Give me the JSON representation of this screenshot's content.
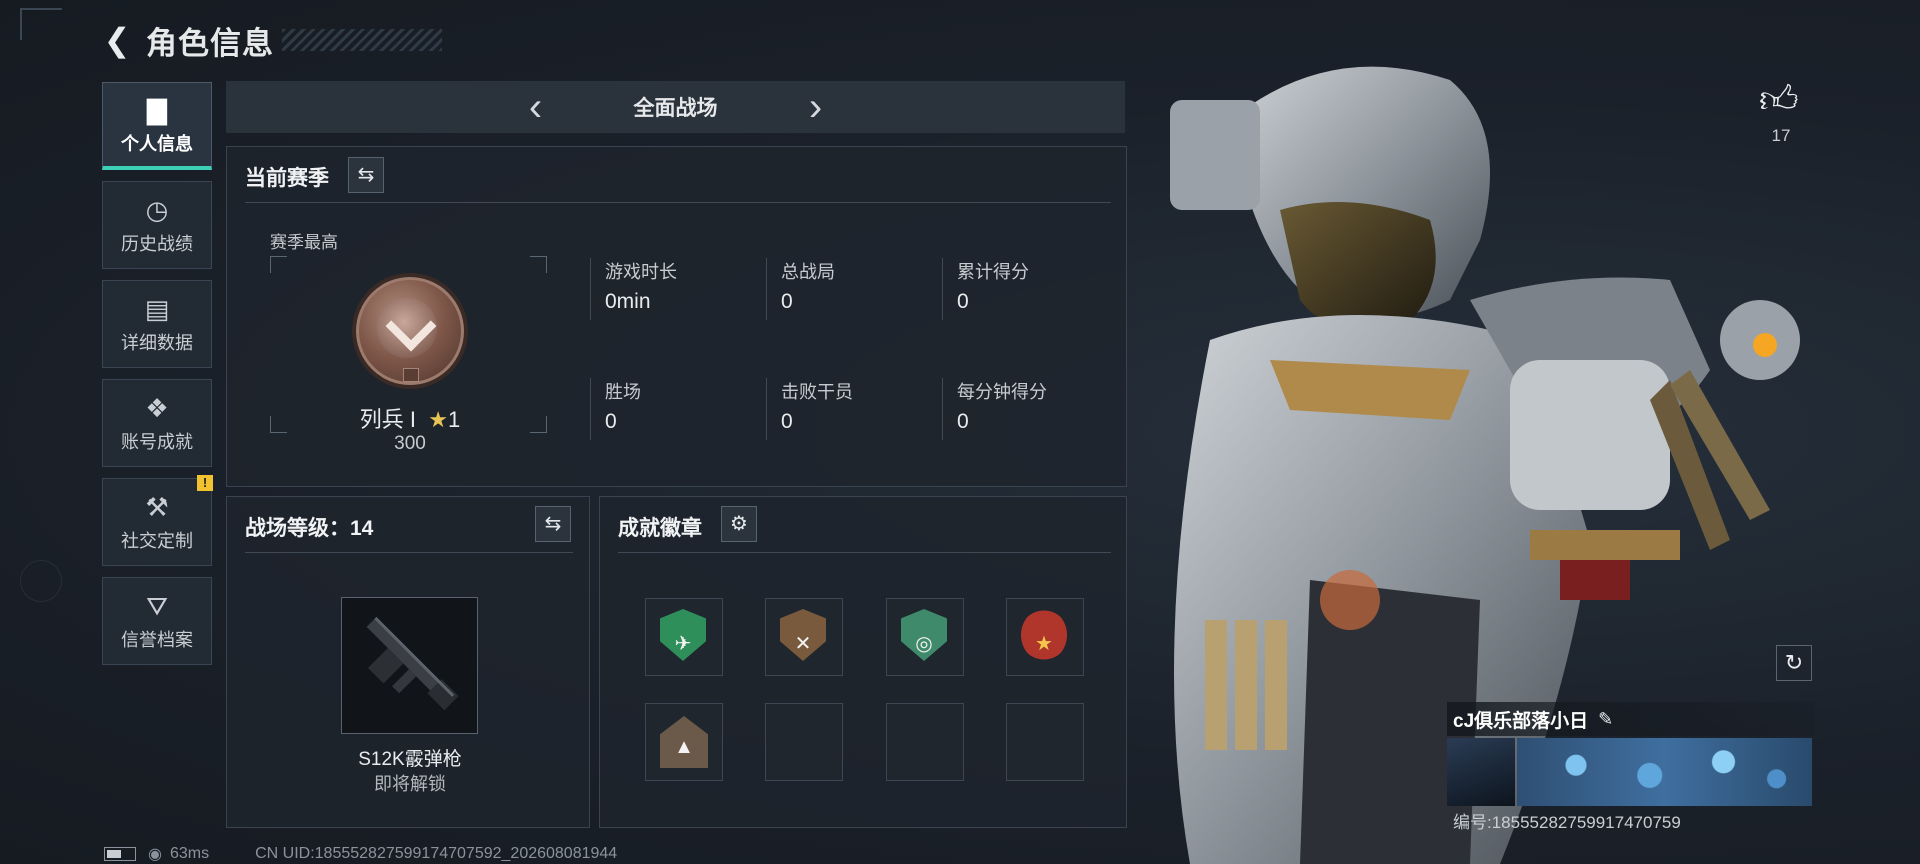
{
  "header": {
    "title": "角色信息"
  },
  "sidebar": {
    "items": [
      {
        "label": "个人信息"
      },
      {
        "label": "历史战绩"
      },
      {
        "label": "详细数据"
      },
      {
        "label": "账号成就"
      },
      {
        "label": "社交定制",
        "alert": "!"
      },
      {
        "label": "信誉档案"
      }
    ]
  },
  "mode": {
    "title": "全面战场"
  },
  "season": {
    "title": "当前赛季",
    "best_label": "赛季最高",
    "rank_name": "列兵 I",
    "rank_stars": "1",
    "rank_points": "300",
    "stats": [
      {
        "label": "游戏时长",
        "value": "0min"
      },
      {
        "label": "总战局",
        "value": "0"
      },
      {
        "label": "累计得分",
        "value": "0"
      },
      {
        "label": "胜场",
        "value": "0"
      },
      {
        "label": "击败干员",
        "value": "0"
      },
      {
        "label": "每分钟得分",
        "value": "0"
      }
    ]
  },
  "level": {
    "title": "战场等级：14",
    "weapon_name": "S12K霰弹枪",
    "weapon_status": "即将解锁"
  },
  "badges": {
    "title": "成就徽章",
    "colors": [
      "#2f8f5a",
      "#7a5a3c",
      "#3f8a6a",
      "#b0362c",
      "#6b5a4a"
    ]
  },
  "profile": {
    "likes": "17",
    "name": "cJ俱乐部落小日",
    "id_line": "编号:18555282759917470759"
  },
  "footer": {
    "latency": "63ms",
    "uid": "CN UID:18555282759917470759​2_202608081944"
  }
}
